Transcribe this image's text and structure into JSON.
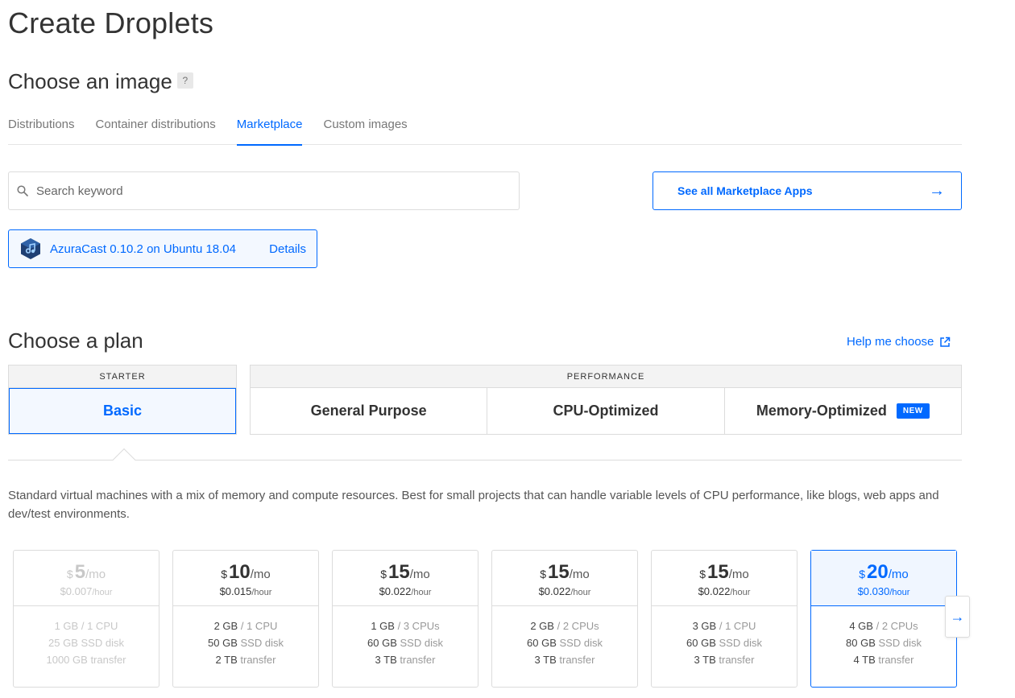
{
  "page_title": "Create Droplets",
  "image_section": {
    "title": "Choose an image",
    "help_badge": "?",
    "tabs": [
      {
        "label": "Distributions",
        "active": false
      },
      {
        "label": "Container distributions",
        "active": false
      },
      {
        "label": "Marketplace",
        "active": true
      },
      {
        "label": "Custom images",
        "active": false
      }
    ],
    "search": {
      "placeholder": "Search keyword",
      "value": ""
    },
    "see_all_button": "See all Marketplace Apps",
    "selected_app": {
      "name": "AzuraCast 0.10.2 on Ubuntu 18.04",
      "details_label": "Details",
      "icon": "azuracast-logo-icon"
    }
  },
  "plan_section": {
    "title": "Choose a plan",
    "help_link": "Help me choose",
    "categories": {
      "starter": {
        "header": "STARTER",
        "options": [
          {
            "label": "Basic",
            "active": true
          }
        ]
      },
      "performance": {
        "header": "PERFORMANCE",
        "options": [
          {
            "label": "General Purpose",
            "active": false
          },
          {
            "label": "CPU-Optimized",
            "active": false
          },
          {
            "label": "Memory-Optimized",
            "active": false,
            "badge": "NEW"
          }
        ]
      }
    },
    "description": "Standard virtual machines with a mix of memory and compute resources. Best for small projects that can handle variable levels of CPU performance, like blogs, web apps and dev/test environments.",
    "plans": [
      {
        "currency": "$",
        "price": "5",
        "per": "/mo",
        "hourly": "$0.007",
        "hourly_unit": "/hour",
        "memory": "1 GB",
        "cpu": "1 CPU",
        "disk_size": "25 GB",
        "disk_label": "SSD disk",
        "transfer_size": "1000 GB",
        "transfer_label": "transfer",
        "state": "disabled"
      },
      {
        "currency": "$",
        "price": "10",
        "per": "/mo",
        "hourly": "$0.015",
        "hourly_unit": "/hour",
        "memory": "2 GB",
        "cpu": "1 CPU",
        "disk_size": "50 GB",
        "disk_label": "SSD disk",
        "transfer_size": "2 TB",
        "transfer_label": "transfer",
        "state": "normal"
      },
      {
        "currency": "$",
        "price": "15",
        "per": "/mo",
        "hourly": "$0.022",
        "hourly_unit": "/hour",
        "memory": "1 GB",
        "cpu": "3 CPUs",
        "disk_size": "60 GB",
        "disk_label": "SSD disk",
        "transfer_size": "3 TB",
        "transfer_label": "transfer",
        "state": "normal"
      },
      {
        "currency": "$",
        "price": "15",
        "per": "/mo",
        "hourly": "$0.022",
        "hourly_unit": "/hour",
        "memory": "2 GB",
        "cpu": "2 CPUs",
        "disk_size": "60 GB",
        "disk_label": "SSD disk",
        "transfer_size": "3 TB",
        "transfer_label": "transfer",
        "state": "normal"
      },
      {
        "currency": "$",
        "price": "15",
        "per": "/mo",
        "hourly": "$0.022",
        "hourly_unit": "/hour",
        "memory": "3 GB",
        "cpu": "1 CPU",
        "disk_size": "60 GB",
        "disk_label": "SSD disk",
        "transfer_size": "3 TB",
        "transfer_label": "transfer",
        "state": "normal"
      },
      {
        "currency": "$",
        "price": "20",
        "per": "/mo",
        "hourly": "$0.030",
        "hourly_unit": "/hour",
        "memory": "4 GB",
        "cpu": "2 CPUs",
        "disk_size": "80 GB",
        "disk_label": "SSD disk",
        "transfer_size": "4 TB",
        "transfer_label": "transfer",
        "state": "selected"
      }
    ],
    "scroll_next_icon": "arrow-right-icon"
  },
  "colors": {
    "accent": "#0069ff",
    "selected_bg": "#f3f8ff",
    "border": "#dcdcdc"
  }
}
